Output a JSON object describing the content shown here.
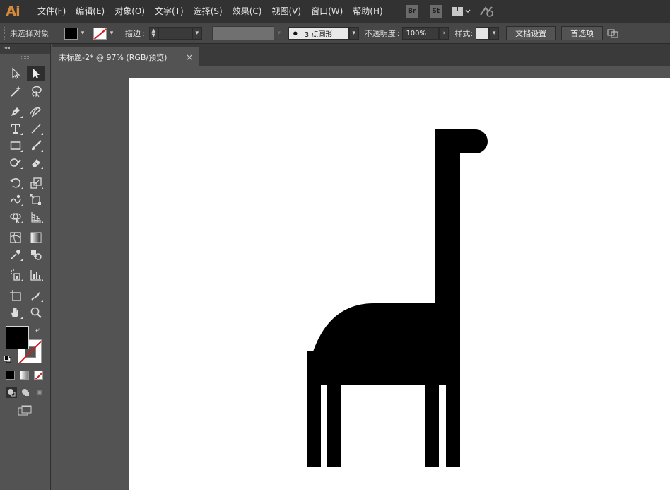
{
  "app": {
    "logo": "Ai"
  },
  "menu": [
    "文件(F)",
    "编辑(E)",
    "对象(O)",
    "文字(T)",
    "选择(S)",
    "效果(C)",
    "视图(V)",
    "窗口(W)",
    "帮助(H)"
  ],
  "bridge_badge": "Br",
  "stock_badge": "St",
  "control": {
    "selection_status": "未选择对象",
    "stroke_label": "描边",
    "brush_value": "3 点圆形",
    "opacity_label": "不透明度",
    "opacity_value": "100%",
    "style_label": "样式",
    "doc_setup_button": "文档设置",
    "prefs_button": "首选项"
  },
  "document_tab": {
    "title": "未标题-2* @ 97% (RGB/预览)",
    "close": "×"
  },
  "colors": {
    "fill": "#000000",
    "stroke": "#ffffff",
    "none_slash": "#d51a1a",
    "accent_logo": "#d78a3b"
  },
  "tools": [
    "selection-tool",
    "direct-selection-tool",
    "magic-wand-tool",
    "lasso-tool",
    "pen-tool",
    "curvature-tool",
    "type-tool",
    "line-segment-tool",
    "rectangle-tool",
    "paintbrush-tool",
    "shaper-tool",
    "eraser-tool",
    "rotate-tool",
    "scale-tool",
    "warp-tool",
    "free-transform-tool",
    "shape-builder-tool",
    "perspective-grid-tool",
    "mesh-tool",
    "gradient-tool",
    "eyedropper-tool",
    "blend-tool",
    "symbol-sprayer-tool",
    "column-graph-tool",
    "artboard-tool",
    "slice-tool",
    "hand-tool",
    "zoom-tool"
  ]
}
